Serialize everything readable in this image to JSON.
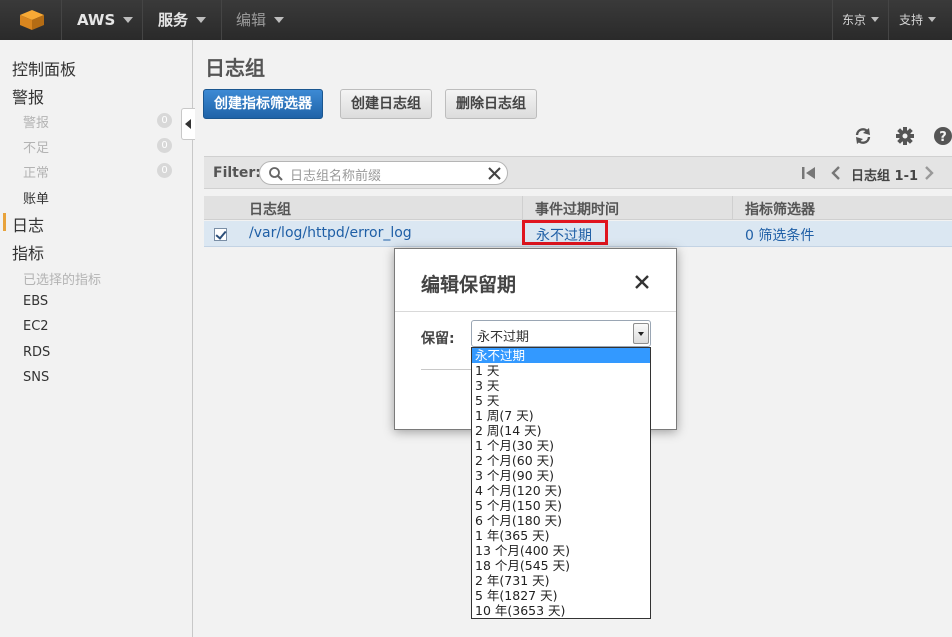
{
  "topbar": {
    "brand": "AWS",
    "services": "服务",
    "edit": "编辑",
    "region": "东京",
    "support": "支持"
  },
  "sidebar": {
    "dashboard": "控制面板",
    "alarms": "警报",
    "alarm_states": [
      {
        "label": "警报",
        "count": "0"
      },
      {
        "label": "不足",
        "count": "0"
      },
      {
        "label": "正常",
        "count": "0"
      }
    ],
    "billing": "账单",
    "logs": "日志",
    "metrics": "指标",
    "selected_metrics": "已选择的指标",
    "metric_namespaces": [
      "EBS",
      "EC2",
      "RDS",
      "SNS"
    ]
  },
  "main": {
    "title": "日志组",
    "buttons": {
      "create_filter": "创建指标筛选器",
      "create_group": "创建日志组",
      "delete_group": "删除日志组"
    },
    "filter": {
      "label": "Filter:",
      "placeholder": "日志组名称前缀",
      "pager_text": "日志组 1-1"
    },
    "table": {
      "headers": [
        "日志组",
        "事件过期时间",
        "指标筛选器"
      ],
      "rows": [
        {
          "selected": true,
          "log_group": "/var/log/httpd/error_log",
          "expiration": "永不过期",
          "filters": "0 筛选条件"
        }
      ]
    }
  },
  "modal": {
    "title": "编辑保留期",
    "field_label": "保留:",
    "selected_value": "永不过期",
    "options": [
      "永不过期",
      "1 天",
      "3 天",
      "5 天",
      "1 周(7 天)",
      "2 周(14 天)",
      "1 个月(30 天)",
      "2 个月(60 天)",
      "3 个月(90 天)",
      "4 个月(120 天)",
      "5 个月(150 天)",
      "6 个月(180 天)",
      "1 年(365 天)",
      "13 个月(400 天)",
      "18 个月(545 天)",
      "2 年(731 天)",
      "5 年(1827 天)",
      "10 年(3653 天)"
    ]
  },
  "colors": {
    "primary_button": "#2a74bf",
    "highlight_box": "#e0141e",
    "dropdown_selected": "#3399ff",
    "link": "#1f5fa6"
  }
}
